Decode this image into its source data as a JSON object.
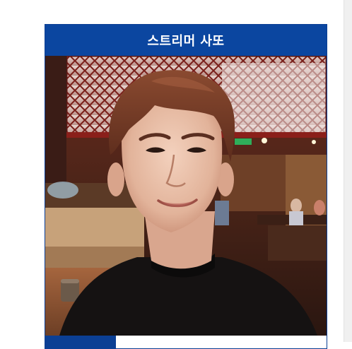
{
  "card": {
    "title": "스트리머 사또",
    "photo_alt": "streamer-profile-photo",
    "info": {
      "label": "",
      "value": ""
    }
  },
  "colors": {
    "header_bg": "#0b46a0",
    "header_text": "#ffffff",
    "border": "#0b3f94"
  }
}
